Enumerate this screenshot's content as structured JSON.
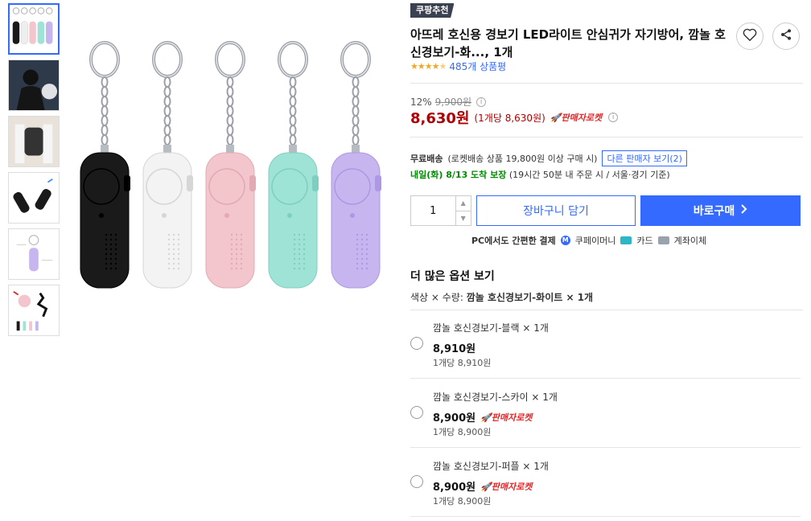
{
  "badge": "쿠팡추천",
  "product": {
    "title": "아뜨레 호신용 경보기 LED라이트 안심귀가 자기방어, 깜놀 호신경보기-화..., 1개",
    "rating_stars": 4.5,
    "review_count": "485개 상품평"
  },
  "price": {
    "discount": "12%",
    "original": "9,900원",
    "final": "8,630원",
    "unit": "(1개당 8,630원)",
    "seller_rocket": "판매자로켓"
  },
  "shipping": {
    "free": "무료배송",
    "condition": "(로켓배송 상품 19,800원 이상 구매 시)",
    "other_seller": "다른 판매자 보기(2)",
    "arrival_day": "내일(화) 8/13 도착 보장",
    "arrival_detail": "(19시간 50분  내 주문 시 / 서울·경기 기준)"
  },
  "purchase": {
    "quantity": "1",
    "cart_label": "장바구니 담기",
    "buy_label": "바로구매",
    "pay_text": "PC에서도 간편한 결제",
    "coupay": "쿠페이머니",
    "card": "카드",
    "transfer": "계좌이체"
  },
  "options": {
    "heading": "더 많은 옵션 보기",
    "selected_prefix": "색상 × 수량:",
    "selected_value": "깜놀 호신경보기-화이트 × 1개",
    "items": [
      {
        "name": "깜놀 호신경보기-블랙 × 1개",
        "price": "8,910원",
        "unit": "1개당 8,910원",
        "rocket": ""
      },
      {
        "name": "깜놀 호신경보기-스카이 × 1개",
        "price": "8,900원",
        "unit": "1개당 8,900원",
        "rocket": "판매자로켓"
      },
      {
        "name": "깜놀 호신경보기-퍼플 × 1개",
        "price": "8,900원",
        "unit": "1개당 8,900원",
        "rocket": "판매자로켓"
      }
    ]
  },
  "colors": {
    "accent": "#346aff",
    "price_red": "#ae0000",
    "rocket_red": "#e52528",
    "arrival_green": "#008c00",
    "device_colors": [
      "#1a1a1a",
      "#f3f3f3",
      "#f2c6cc",
      "#9ee3d6",
      "#c7b5f0"
    ]
  },
  "icons": [
    "heart-icon",
    "share-icon",
    "chevron-right-icon",
    "info-icon",
    "rocket-icon"
  ]
}
